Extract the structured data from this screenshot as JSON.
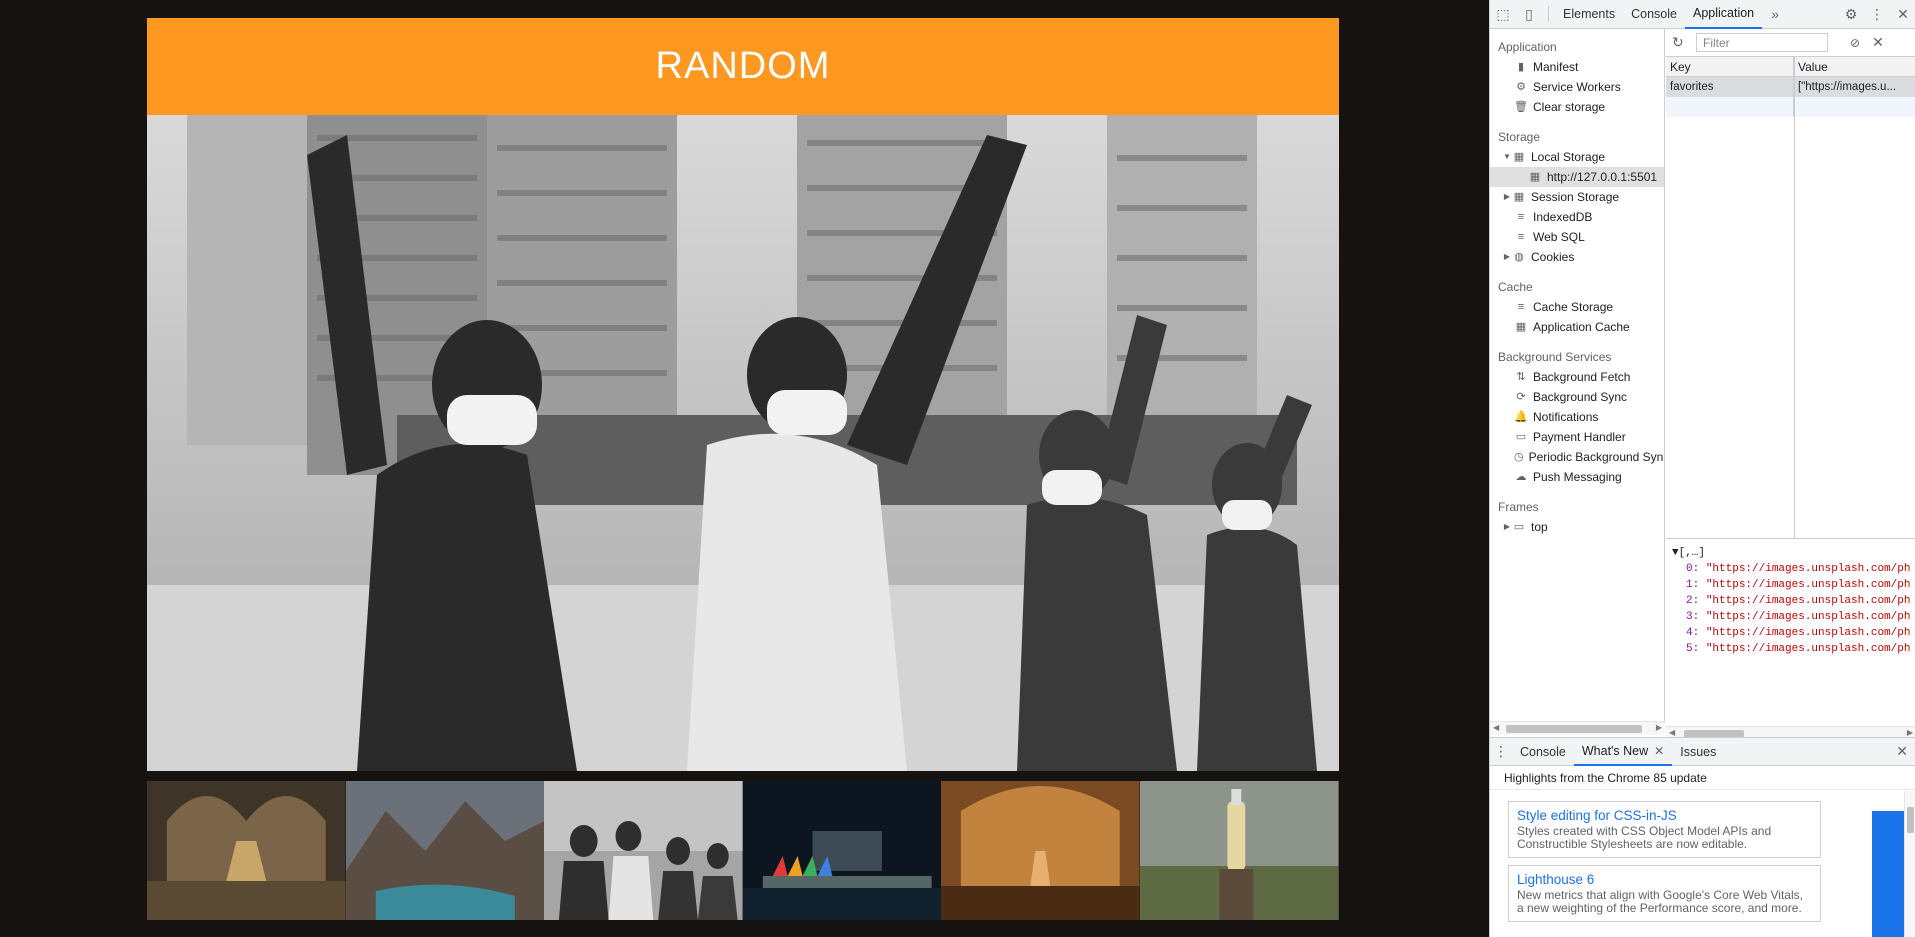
{
  "page": {
    "banner_title": "RANDOM",
    "hero_alt": "protest-photo",
    "thumbnails": [
      "cathedral-nave-thumbnail",
      "mountain-lake-thumbnail",
      "protest-thumbnail",
      "night-harbor-thumbnail",
      "church-interior-thumbnail",
      "bottle-field-thumbnail"
    ]
  },
  "devtools": {
    "tabs": [
      "Elements",
      "Console",
      "Application"
    ],
    "active_tab": "Application",
    "sidebar": {
      "application_header": "Application",
      "application_items": [
        "Manifest",
        "Service Workers",
        "Clear storage"
      ],
      "storage_header": "Storage",
      "local_storage": "Local Storage",
      "local_origin": "http://127.0.0.1:5501",
      "session_storage": "Session Storage",
      "indexeddb": "IndexedDB",
      "websql": "Web SQL",
      "cookies": "Cookies",
      "cache_header": "Cache",
      "cache_storage": "Cache Storage",
      "application_cache": "Application Cache",
      "bg_header": "Background Services",
      "bg_items": [
        "Background Fetch",
        "Background Sync",
        "Notifications",
        "Payment Handler",
        "Periodic Background Sync",
        "Push Messaging"
      ],
      "frames_header": "Frames",
      "frames_top": "top"
    },
    "filter_placeholder": "Filter",
    "table": {
      "col_key": "Key",
      "col_value": "Value",
      "rows": [
        {
          "key": "favorites",
          "value": "[\"https://images.u..."
        }
      ]
    },
    "preview": {
      "head": "▼[,…]",
      "items": [
        {
          "idx": "0:",
          "val": "\"https://images.unsplash.com/ph"
        },
        {
          "idx": "1:",
          "val": "\"https://images.unsplash.com/ph"
        },
        {
          "idx": "2:",
          "val": "\"https://images.unsplash.com/ph"
        },
        {
          "idx": "3:",
          "val": "\"https://images.unsplash.com/ph"
        },
        {
          "idx": "4:",
          "val": "\"https://images.unsplash.com/ph"
        },
        {
          "idx": "5:",
          "val": "\"https://images.unsplash.com/ph"
        }
      ]
    },
    "drawer": {
      "tabs": [
        "Console",
        "What's New",
        "Issues"
      ],
      "active_tab": "What's New",
      "highlights": "Highlights from the Chrome 85 update",
      "cards": [
        {
          "title": "Style editing for CSS-in-JS",
          "desc": "Styles created with CSS Object Model APIs and Constructible Stylesheets are now editable."
        },
        {
          "title": "Lighthouse 6",
          "desc": "New metrics that align with Google's Core Web Vitals, a new weighting of the Performance score, and more."
        }
      ]
    }
  }
}
